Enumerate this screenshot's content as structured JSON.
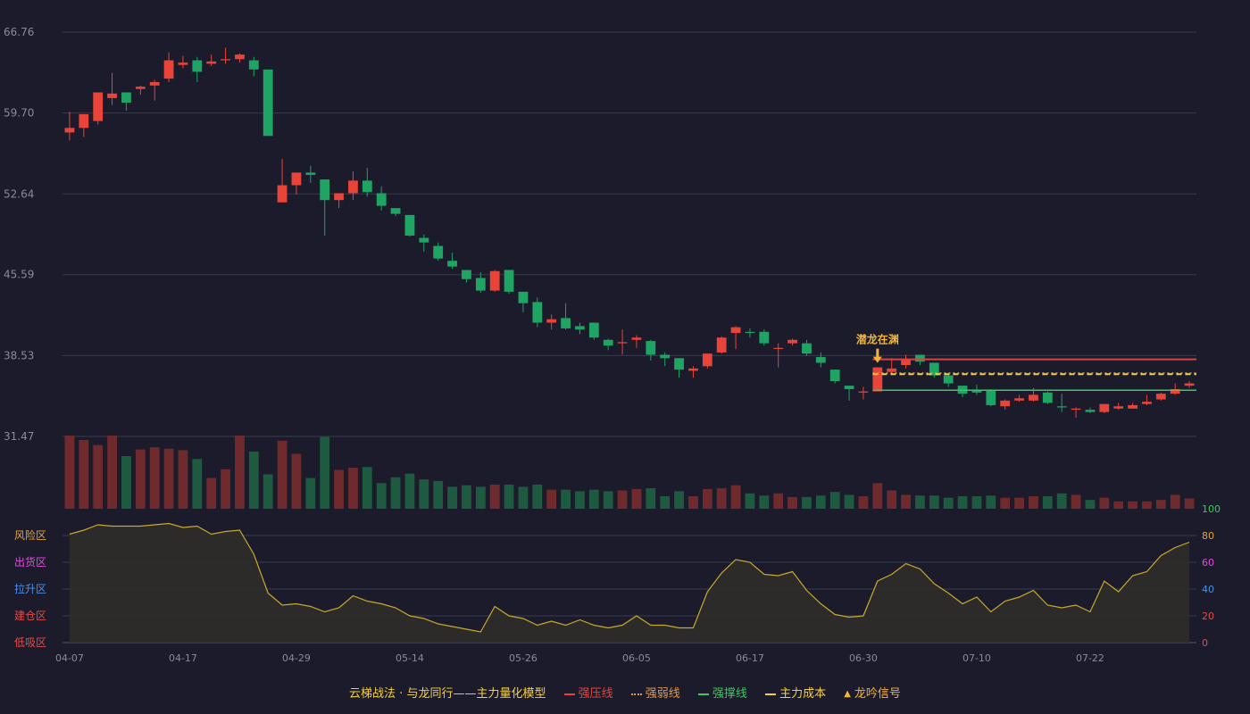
{
  "colors": {
    "background": "#1b1b2b",
    "up": "#e8443a",
    "down": "#1fa463",
    "up_volume": "#6e2a2d",
    "down_volume": "#1e5a40",
    "grid": "#3a3b4c",
    "axis_text": "#8b8b95",
    "resistance": "#d84343",
    "weak": "#e39a4a",
    "support": "#3ec95c",
    "cost": "#f4d03f",
    "oscillator_line": "#c8a92a",
    "oscillator_fill": "#2f2d2a",
    "signal": "#f2b43a"
  },
  "chart_data": [
    {
      "type": "candlestick",
      "y_ticks": [
        "66.76",
        "59.70",
        "52.64",
        "45.59",
        "38.53",
        "31.47"
      ],
      "ylim": [
        31.47,
        66.76
      ],
      "x_ticks": [
        "04-07",
        "04-17",
        "04-29",
        "05-14",
        "05-26",
        "06-05",
        "06-17",
        "06-30",
        "07-10",
        "07-22"
      ],
      "x_tick_index": [
        0,
        8,
        16,
        24,
        32,
        40,
        48,
        56,
        64,
        72
      ],
      "candles": [
        [
          58.0,
          58.4,
          59.8,
          57.3
        ],
        [
          58.4,
          59.6,
          59.6,
          57.6
        ],
        [
          59.0,
          61.5,
          61.5,
          58.7
        ],
        [
          61.0,
          61.4,
          63.2,
          60.4
        ],
        [
          61.5,
          60.6,
          61.5,
          59.9
        ],
        [
          61.8,
          62.0,
          62.1,
          61.3
        ],
        [
          62.1,
          62.4,
          62.6,
          60.8
        ],
        [
          62.7,
          64.3,
          65.0,
          62.4
        ],
        [
          63.9,
          64.1,
          64.7,
          63.6
        ],
        [
          64.3,
          63.3,
          64.6,
          62.4
        ],
        [
          64.0,
          64.2,
          64.8,
          63.8
        ],
        [
          64.3,
          64.4,
          65.4,
          64.0
        ],
        [
          64.4,
          64.8,
          64.9,
          64.1
        ],
        [
          64.3,
          63.5,
          64.6,
          62.9
        ],
        [
          63.5,
          57.7,
          63.5,
          57.7
        ],
        [
          51.9,
          53.4,
          55.7,
          51.9
        ],
        [
          53.4,
          54.5,
          54.5,
          52.6
        ],
        [
          54.5,
          54.3,
          55.1,
          53.6
        ],
        [
          53.9,
          52.1,
          53.9,
          49.0
        ],
        [
          52.1,
          52.7,
          52.7,
          51.4
        ],
        [
          52.7,
          53.8,
          54.6,
          52.1
        ],
        [
          53.8,
          52.8,
          54.9,
          52.4
        ],
        [
          52.7,
          51.6,
          53.3,
          51.2
        ],
        [
          51.4,
          50.9,
          51.4,
          50.7
        ],
        [
          50.8,
          49.0,
          50.8,
          48.9
        ],
        [
          48.8,
          48.4,
          49.1,
          47.6
        ],
        [
          48.1,
          47.0,
          48.4,
          46.8
        ],
        [
          46.8,
          46.3,
          47.5,
          46.1
        ],
        [
          46.0,
          45.2,
          46.0,
          44.9
        ],
        [
          45.3,
          44.2,
          45.8,
          44.0
        ],
        [
          44.2,
          45.9,
          46.0,
          44.1
        ],
        [
          46.0,
          44.1,
          46.0,
          43.9
        ],
        [
          44.1,
          43.1,
          44.1,
          42.3
        ],
        [
          43.2,
          41.4,
          43.6,
          41.0
        ],
        [
          41.4,
          41.7,
          42.1,
          40.8
        ],
        [
          41.8,
          40.9,
          43.1,
          40.8
        ],
        [
          41.1,
          40.8,
          41.4,
          40.4
        ],
        [
          41.4,
          40.1,
          41.4,
          39.9
        ],
        [
          39.9,
          39.4,
          40.0,
          39.0
        ],
        [
          39.6,
          39.7,
          40.8,
          38.6
        ],
        [
          39.9,
          40.1,
          40.3,
          39.2
        ],
        [
          39.8,
          38.6,
          39.9,
          38.1
        ],
        [
          38.6,
          38.3,
          38.8,
          37.6
        ],
        [
          38.3,
          37.3,
          38.3,
          36.6
        ],
        [
          37.2,
          37.4,
          37.6,
          36.6
        ],
        [
          37.6,
          38.7,
          38.7,
          37.4
        ],
        [
          38.8,
          40.1,
          40.2,
          38.7
        ],
        [
          40.5,
          41.0,
          41.1,
          39.1
        ],
        [
          40.6,
          40.5,
          40.9,
          40.1
        ],
        [
          40.6,
          39.6,
          40.8,
          39.4
        ],
        [
          39.2,
          39.2,
          39.6,
          37.5
        ],
        [
          39.6,
          39.9,
          40.0,
          39.4
        ],
        [
          39.6,
          38.7,
          39.9,
          38.5
        ],
        [
          38.4,
          37.9,
          38.8,
          37.5
        ],
        [
          37.3,
          36.3,
          37.3,
          36.1
        ],
        [
          35.9,
          35.6,
          35.9,
          34.6
        ],
        [
          35.3,
          35.4,
          35.8,
          34.7
        ],
        [
          35.4,
          37.5,
          37.5,
          35.4
        ],
        [
          37.1,
          37.4,
          38.3,
          37.0
        ],
        [
          37.7,
          38.2,
          38.6,
          37.4
        ],
        [
          38.6,
          38.0,
          38.6,
          37.7
        ],
        [
          37.9,
          36.8,
          37.9,
          36.6
        ],
        [
          36.8,
          36.1,
          36.9,
          35.8
        ],
        [
          35.9,
          35.2,
          35.9,
          34.9
        ],
        [
          35.5,
          35.3,
          36.0,
          35.1
        ],
        [
          35.5,
          34.2,
          35.6,
          34.1
        ],
        [
          34.1,
          34.6,
          34.7,
          33.8
        ],
        [
          34.6,
          34.8,
          35.1,
          34.5
        ],
        [
          34.6,
          35.1,
          35.7,
          34.5
        ],
        [
          35.3,
          34.4,
          35.4,
          34.3
        ],
        [
          34.1,
          34.0,
          35.2,
          33.6
        ],
        [
          33.8,
          33.9,
          34.0,
          33.1
        ],
        [
          33.8,
          33.6,
          34.0,
          33.5
        ],
        [
          33.6,
          34.3,
          34.3,
          33.5
        ],
        [
          33.9,
          34.1,
          34.4,
          33.8
        ],
        [
          33.9,
          34.2,
          34.4,
          33.9
        ],
        [
          34.3,
          34.5,
          35.1,
          34.2
        ],
        [
          34.7,
          35.2,
          35.3,
          34.6
        ],
        [
          35.2,
          35.6,
          36.1,
          35.1
        ],
        [
          35.9,
          36.1,
          36.3,
          35.7
        ]
      ],
      "levels": [
        {
          "name": "强压线",
          "value": 38.2,
          "start": 57
        },
        {
          "name": "强弱线",
          "value": 37.0,
          "start": 57
        },
        {
          "name": "主力成本",
          "value": 36.9,
          "start": 57
        },
        {
          "name": "强撑线",
          "value": 35.5,
          "start": 57
        }
      ],
      "signal": {
        "label": "潜龙在渊",
        "index": 57
      }
    },
    {
      "type": "bar",
      "series": "volume",
      "values": [
        100,
        94,
        87,
        100,
        72,
        81,
        84,
        82,
        80,
        68,
        42,
        54,
        100,
        78,
        47,
        93,
        75,
        42,
        98,
        53,
        56,
        57,
        35,
        43,
        48,
        40,
        38,
        30,
        32,
        30,
        33,
        33,
        30,
        33,
        26,
        26,
        24,
        26,
        24,
        25,
        27,
        28,
        17,
        24,
        17,
        27,
        28,
        32,
        21,
        18,
        21,
        16,
        16,
        18,
        23,
        19,
        17,
        35,
        25,
        19,
        18,
        18,
        15,
        17,
        17,
        18,
        15,
        15,
        17,
        17,
        21,
        19,
        12,
        15,
        10,
        10,
        10,
        12,
        19,
        14
      ]
    },
    {
      "type": "area",
      "y_ticks": [
        "100",
        "80",
        "60",
        "40",
        "20",
        "0"
      ],
      "ylim": [
        0,
        100
      ],
      "zones": [
        "风险区",
        "出货区",
        "拉升区",
        "建仓区",
        "低吸区"
      ],
      "values": [
        81,
        84,
        88,
        87,
        87,
        87,
        88,
        89,
        86,
        87,
        81,
        83,
        84,
        66,
        37,
        28,
        29,
        27,
        23,
        26,
        35,
        31,
        29,
        26,
        20,
        18,
        14,
        12,
        10,
        8,
        27,
        20,
        18,
        13,
        16,
        13,
        17,
        13,
        11,
        13,
        20,
        13,
        13,
        11,
        11,
        38,
        52,
        62,
        60,
        51,
        50,
        53,
        39,
        29,
        21,
        19,
        20,
        46,
        51,
        59,
        55,
        44,
        37,
        29,
        34,
        23,
        31,
        34,
        39,
        28,
        26,
        28,
        23,
        46,
        38,
        50,
        53,
        65,
        71,
        75
      ]
    }
  ],
  "legend": {
    "title": "云梯战法 · 与龙同行——主力量化模型",
    "items": [
      {
        "label": "强压线",
        "color": "#e8443a",
        "style": "solid"
      },
      {
        "label": "强弱线",
        "color": "#e39a4a",
        "style": "dotted"
      },
      {
        "label": "强撑线",
        "color": "#3ec95c",
        "style": "solid"
      },
      {
        "label": "主力成本",
        "color": "#f4d03f",
        "style": "dashed"
      },
      {
        "label": "龙吟信号",
        "color": "#f2b43a",
        "style": "triangle"
      }
    ]
  },
  "zone_colors": [
    "#e8a23a",
    "#e84ae0",
    "#4a8fe8",
    "#e84a4a",
    "#e84a4a"
  ],
  "osc_tick_colors": [
    "#3ec95c",
    "#e8a23a",
    "#e84ae0",
    "#4a8fe8",
    "#e84a4a",
    "#e84a4a"
  ]
}
